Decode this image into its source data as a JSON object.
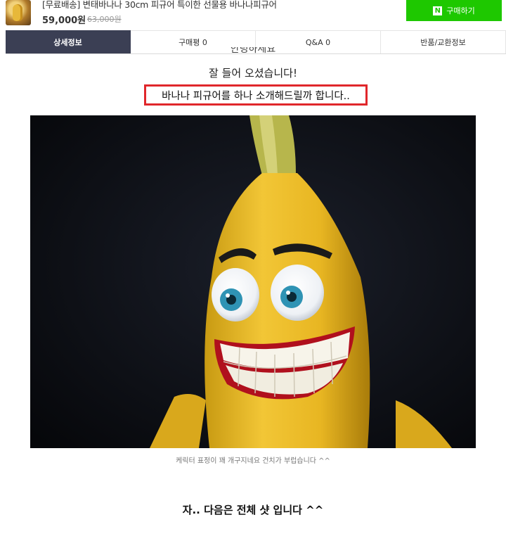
{
  "product": {
    "title": "[무료배송] 변태바나나 30cm 피규어 특이한 선물용 바나나피규어",
    "price": "59,000원",
    "original_price": "63,000원",
    "buy_button_label": "구매하기",
    "buy_button_icon_letter": "N"
  },
  "tabs": [
    {
      "label": "상세정보",
      "active": true
    },
    {
      "label": "구매평 0",
      "active": false
    },
    {
      "label": "Q&A 0",
      "active": false
    },
    {
      "label": "반품/교환정보",
      "active": false
    }
  ],
  "content": {
    "partial_line": "안녕하세요",
    "welcome": "잘 들어 오셨습니다!",
    "highlight": "바나나 피규어를 하나 소개해드릴까 합니다..",
    "caption": "케릭터 표정이 꽤 개구지네요 건치가 부럽습니다 ^^",
    "next": "자.. 다음은 전체 샷 입니다 ^^"
  },
  "colors": {
    "buy_button": "#1ec800",
    "active_tab": "#3b3f54",
    "highlight_border": "#e0272b"
  }
}
